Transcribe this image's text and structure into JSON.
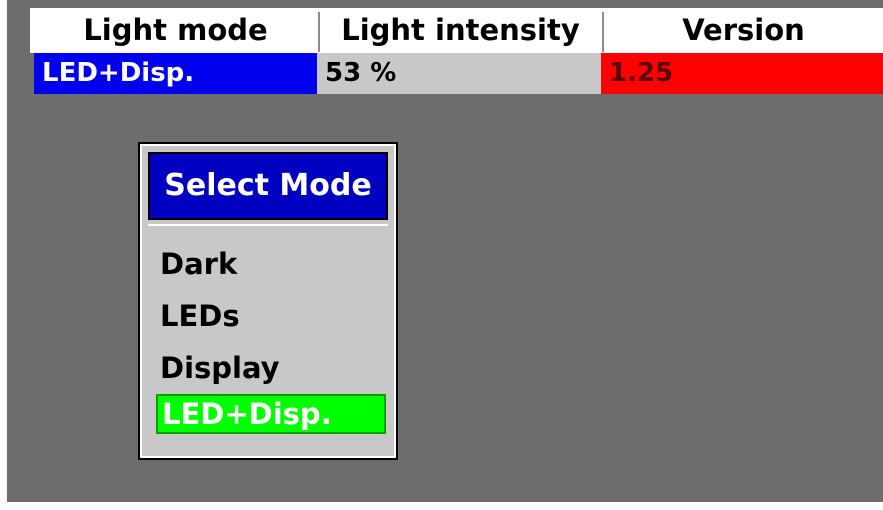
{
  "header": {
    "columns": [
      "Light mode",
      "Light intensity",
      "Version"
    ]
  },
  "values": {
    "light_mode": "LED+Disp.",
    "light_intensity": "53 %",
    "version": "1.25"
  },
  "select_mode_popup": {
    "title": "Select Mode",
    "options": [
      "Dark",
      "LEDs",
      "Display",
      "LED+Disp."
    ],
    "selected_option": "LED+Disp."
  },
  "colors": {
    "display_background": "#6d6d6d",
    "light_mode_cell": "#0000ee",
    "intensity_cell": "#c8c8c8",
    "version_cell": "#ff0000",
    "popup_title": "#0000c0",
    "selected_option": "#00ff00"
  }
}
